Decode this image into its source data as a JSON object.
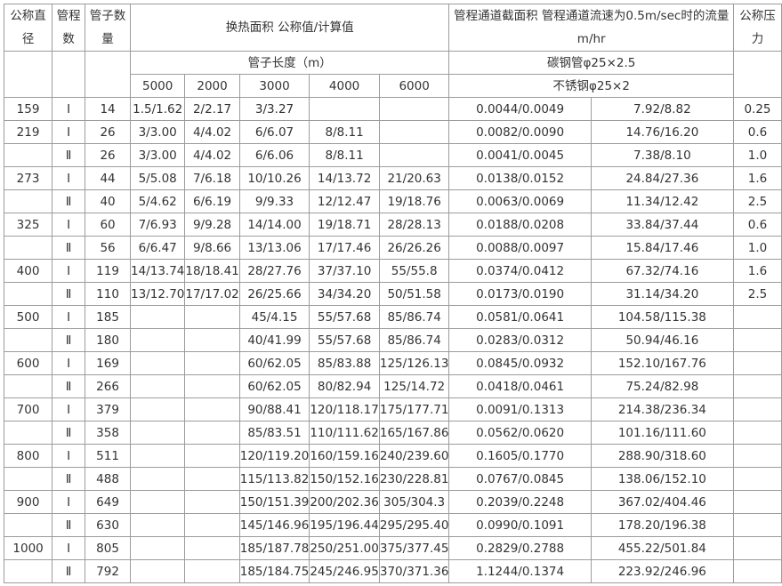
{
  "header": {
    "nominal_diameter": "公称直径",
    "tube_passes": "管程数",
    "tube_count": "管子数量",
    "heat_area": "换热面积 公称值/计算值",
    "tube_length": "管子长度（m）",
    "lengths": [
      "5000",
      "2000",
      "3000",
      "4000",
      "6000"
    ],
    "channel": "管程通道截面积 管程通道流速为0.5m/sec时的流量m/hr",
    "carbon_steel": "碳钢管φ25×2.5",
    "stainless_steel": "不锈钢φ25×2",
    "nominal_pressure": "公称压力"
  },
  "rows": [
    [
      "159",
      "Ⅰ",
      "14",
      "1.5/1.62",
      "2/2.17",
      "3/3.27",
      "",
      "",
      "0.0044/0.0049",
      "7.92/8.82",
      "0.25"
    ],
    [
      "219",
      "Ⅰ",
      "26",
      "3/3.00",
      "4/4.02",
      "6/6.07",
      "8/8.11",
      "",
      "0.0082/0.0090",
      "14.76/16.20",
      "0.6"
    ],
    [
      "",
      "Ⅱ",
      "26",
      "3/3.00",
      "4/4.02",
      "6/6.06",
      "8/8.11",
      "",
      "0.0041/0.0045",
      "7.38/8.10",
      "1.0"
    ],
    [
      "273",
      "Ⅰ",
      "44",
      "5/5.08",
      "7/6.18",
      "10/10.26",
      "14/13.72",
      "21/20.63",
      "0.0138/0.0152",
      "24.84/27.36",
      "1.6"
    ],
    [
      "",
      "Ⅱ",
      "40",
      "5/4.62",
      "6/6.19",
      "9/9.33",
      "12/12.47",
      "19/18.76",
      "0.0063/0.0069",
      "11.34/12.42",
      "2.5"
    ],
    [
      "325",
      "Ⅰ",
      "60",
      "7/6.93",
      "9/9.28",
      "14/14.00",
      "19/18.71",
      "28/28.13",
      "0.0188/0.0208",
      "33.84/37.44",
      "0.6"
    ],
    [
      "",
      "Ⅱ",
      "56",
      "6/6.47",
      "9/8.66",
      "13/13.06",
      "17/17.46",
      "26/26.26",
      "0.0088/0.0097",
      "15.84/17.46",
      "1.0"
    ],
    [
      "400",
      "Ⅰ",
      "119",
      "14/13.74",
      "18/18.41",
      "28/27.76",
      "37/37.10",
      "55/55.8",
      "0.0374/0.0412",
      "67.32/74.16",
      "1.6"
    ],
    [
      "",
      "Ⅱ",
      "110",
      "13/12.70",
      "17/17.02",
      "26/25.66",
      "34/34.20",
      "50/51.58",
      "0.0173/0.0190",
      "31.14/34.20",
      "2.5"
    ],
    [
      "500",
      "Ⅰ",
      "185",
      "",
      "",
      "45/4.15",
      "55/57.68",
      "85/86.74",
      "0.0581/0.0641",
      "104.58/115.38",
      ""
    ],
    [
      "",
      "Ⅱ",
      "180",
      "",
      "",
      "40/41.99",
      "55/57.68",
      "85/86.74",
      "0.0283/0.0312",
      "50.94/46.16",
      ""
    ],
    [
      "600",
      "Ⅰ",
      "169",
      "",
      "",
      "60/62.05",
      "85/83.88",
      "125/126.13",
      "0.0845/0.0932",
      "152.10/167.76",
      ""
    ],
    [
      "",
      "Ⅱ",
      "266",
      "",
      "",
      "60/62.05",
      "80/82.94",
      "125/14.72",
      "0.0418/0.0461",
      "75.24/82.98",
      ""
    ],
    [
      "700",
      "Ⅰ",
      "379",
      "",
      "",
      "90/88.41",
      "120/118.17",
      "175/177.71",
      "0.0091/0.1313",
      "214.38/236.34",
      ""
    ],
    [
      "",
      "Ⅱ",
      "358",
      "",
      "",
      "85/83.51",
      "110/111.62",
      "165/167.86",
      "0.0562/0.0620",
      "101.16/111.60",
      ""
    ],
    [
      "800",
      "Ⅰ",
      "511",
      "",
      "",
      "120/119.20",
      "160/159.16",
      "240/239.60",
      "0.1605/0.1770",
      "288.90/318.60",
      ""
    ],
    [
      "",
      "Ⅱ",
      "488",
      "",
      "",
      "115/113.82",
      "150/152.16",
      "230/228.81",
      "0.0767/0.0845",
      "138.06/152.10",
      ""
    ],
    [
      "900",
      "Ⅰ",
      "649",
      "",
      "",
      "150/151.39",
      "200/202.36",
      "305/304.3",
      "0.2039/0.2248",
      "367.02/404.46",
      ""
    ],
    [
      "",
      "Ⅱ",
      "630",
      "",
      "",
      "145/146.96",
      "195/196.44",
      "295/295.40",
      "0.0990/0.1091",
      "178.20/196.38",
      ""
    ],
    [
      "1000",
      "Ⅰ",
      "805",
      "",
      "",
      "185/187.78",
      "250/251.00",
      "375/377.45",
      "0.2829/0.2788",
      "455.22/501.84",
      ""
    ],
    [
      "",
      "Ⅱ",
      "792",
      "",
      "",
      "185/184.75",
      "245/246.95",
      "370/371.36",
      "1.1244/0.1374",
      "223.92/246.96",
      ""
    ]
  ]
}
